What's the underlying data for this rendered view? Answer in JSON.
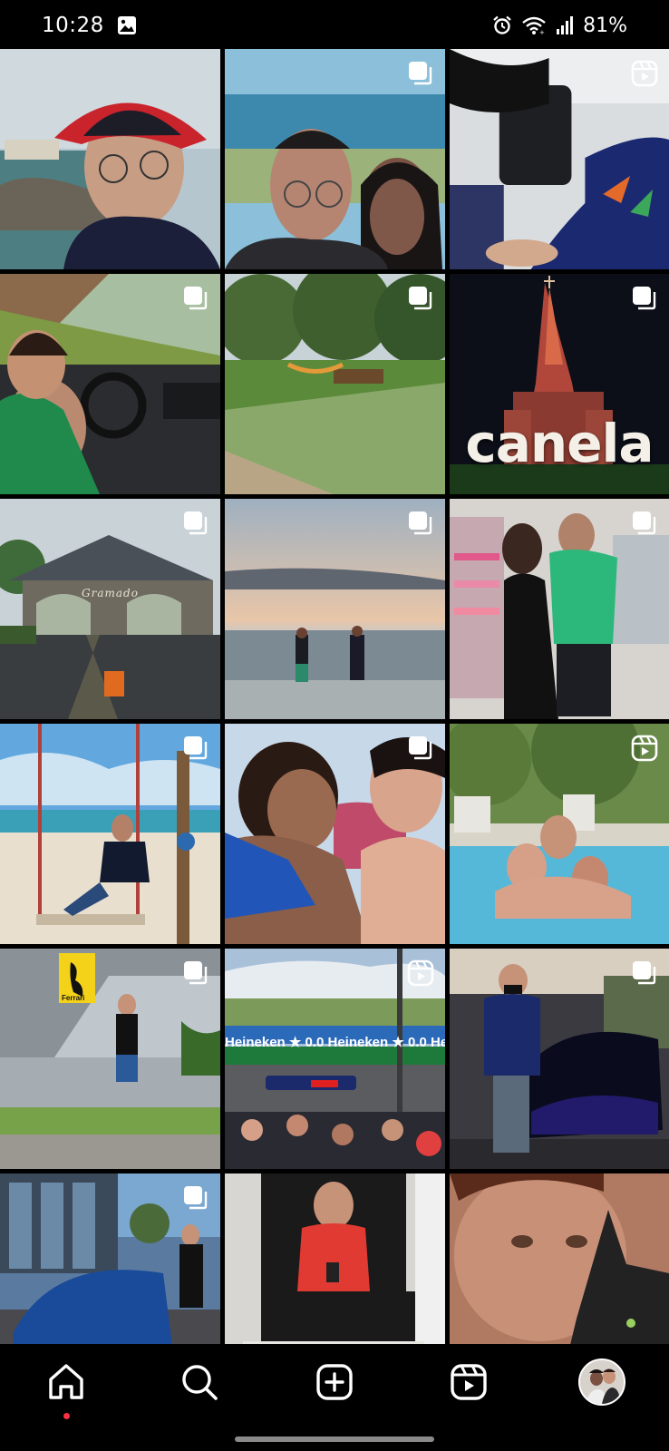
{
  "status_bar": {
    "time": "10:28",
    "battery": "81%",
    "icons": [
      "gallery-icon",
      "alarm-icon",
      "wifi-icon",
      "signal-icon"
    ]
  },
  "grid": {
    "tiles": [
      {
        "subject": "selfie-cap-coast",
        "badge": "none"
      },
      {
        "subject": "couple-selfie-sea",
        "badge": "carousel"
      },
      {
        "subject": "airport-legs",
        "badge": "reel"
      },
      {
        "subject": "convertible-driving",
        "badge": "carousel"
      },
      {
        "subject": "park-hammocks",
        "badge": "carousel"
      },
      {
        "subject": "canela-cathedral",
        "badge": "carousel",
        "caption": "canela"
      },
      {
        "subject": "gramado-portal",
        "badge": "carousel",
        "caption": "Gramado"
      },
      {
        "subject": "couple-beach-sunset",
        "badge": "carousel"
      },
      {
        "subject": "couple-store-mirror",
        "badge": "carousel"
      },
      {
        "subject": "beach-swing",
        "badge": "carousel"
      },
      {
        "subject": "couple-close",
        "badge": "carousel"
      },
      {
        "subject": "pool-three-people",
        "badge": "reel"
      },
      {
        "subject": "ferrari-building",
        "badge": "carousel",
        "caption": "Ferrari"
      },
      {
        "subject": "f1-race-track",
        "badge": "reel",
        "caption": "Heineken ★ 0.0   Heineken ★ 0.0   Heineken"
      },
      {
        "subject": "lamborghini-show",
        "badge": "carousel"
      },
      {
        "subject": "audi-dealership",
        "badge": "carousel"
      },
      {
        "subject": "man-red-shirt-phone",
        "badge": "none"
      },
      {
        "subject": "selfie-with-cat",
        "badge": "none"
      }
    ]
  },
  "bottom_nav": {
    "items": [
      {
        "name": "home",
        "icon": "home-icon",
        "active": true
      },
      {
        "name": "search",
        "icon": "search-icon"
      },
      {
        "name": "create",
        "icon": "add-post-icon"
      },
      {
        "name": "reels",
        "icon": "reels-icon"
      },
      {
        "name": "profile",
        "icon": "profile-avatar"
      }
    ],
    "active_dot_color": "#ff3040"
  }
}
